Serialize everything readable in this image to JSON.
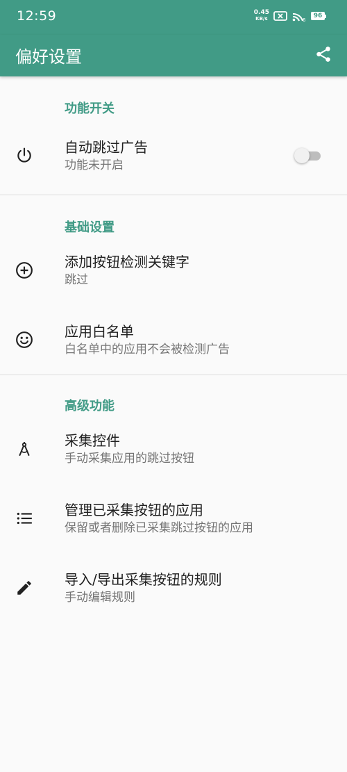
{
  "status_bar": {
    "time": "12:59",
    "net_speed_value": "0.45",
    "net_speed_unit": "KB/s",
    "battery": "96",
    "icons": [
      "sim-disabled-icon",
      "wifi-icon",
      "battery-icon"
    ]
  },
  "app_bar": {
    "title": "偏好设置",
    "share_icon": "share-icon"
  },
  "sections": [
    {
      "header": "功能开关",
      "items": [
        {
          "icon": "power-icon",
          "title": "自动跳过广告",
          "summary": "功能未开启",
          "toggle": false
        }
      ]
    },
    {
      "header": "基础设置",
      "items": [
        {
          "icon": "add-circle-icon",
          "title": "添加按钮检测关键字",
          "summary": "跳过"
        },
        {
          "icon": "smiley-icon",
          "title": "应用白名单",
          "summary": "白名单中的应用不会被检测广告"
        }
      ]
    },
    {
      "header": "高级功能",
      "items": [
        {
          "icon": "compass-icon",
          "title": "采集控件",
          "summary": "手动采集应用的跳过按钮"
        },
        {
          "icon": "list-icon",
          "title": "管理已采集按钮的应用",
          "summary": "保留或者删除已采集跳过按钮的应用"
        },
        {
          "icon": "pencil-icon",
          "title": "导入/导出采集按钮的规则",
          "summary": "手动编辑规则"
        }
      ]
    }
  ],
  "colors": {
    "primary": "#419b86",
    "background": "#fafafa",
    "text_primary": "#212121",
    "text_secondary": "#757575",
    "divider": "#dcdcdc"
  }
}
